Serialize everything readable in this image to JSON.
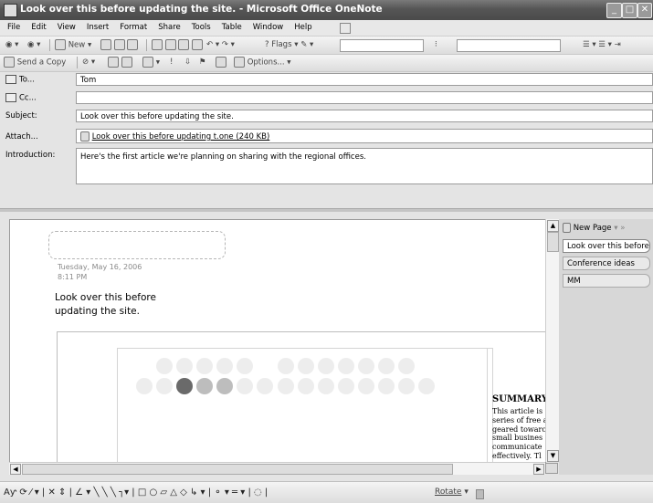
{
  "window": {
    "title": "Look over this before updating the site. - Microsoft Office OneNote"
  },
  "menu": [
    "File",
    "Edit",
    "View",
    "Insert",
    "Format",
    "Share",
    "Tools",
    "Table",
    "Window",
    "Help"
  ],
  "toolbar1": {
    "new_label": "New",
    "flags_label": "Flags"
  },
  "toolbar2": {
    "send_copy_label": "Send a Copy",
    "options_label": "Options..."
  },
  "email": {
    "to_label": "To...",
    "to_value": "Tom",
    "cc_label": "Cc...",
    "cc_value": "",
    "subject_label": "Subject:",
    "subject_value": "Look over this before updating the site.",
    "attach_label": "Attach...",
    "attachment": "Look over this before updating t.one (240 KB)",
    "intro_label": "Introduction:",
    "intro_value": "Here's the first article we're planning on sharing with the regional offices."
  },
  "note": {
    "date": "Tuesday, May 16, 2006",
    "time": "8:11 PM",
    "title_line1": "Look over this before",
    "title_line2": "updating the site.",
    "summary_heading": "SUMMARY:",
    "summary_lines": [
      "This article is",
      "series of free a",
      "geared towarc",
      "small busines",
      "communicate",
      "effectively. Tl"
    ]
  },
  "pages": {
    "new_page_label": "New Page",
    "tabs": [
      "Look over this before",
      "Conference ideas",
      "MM"
    ],
    "selected": 0
  },
  "drawing_toolbar": {
    "rotate_label": "Rotate"
  },
  "colors": {
    "titlebar": "#555555",
    "background": "#e4e4e4",
    "canvas": "#ffffff"
  }
}
